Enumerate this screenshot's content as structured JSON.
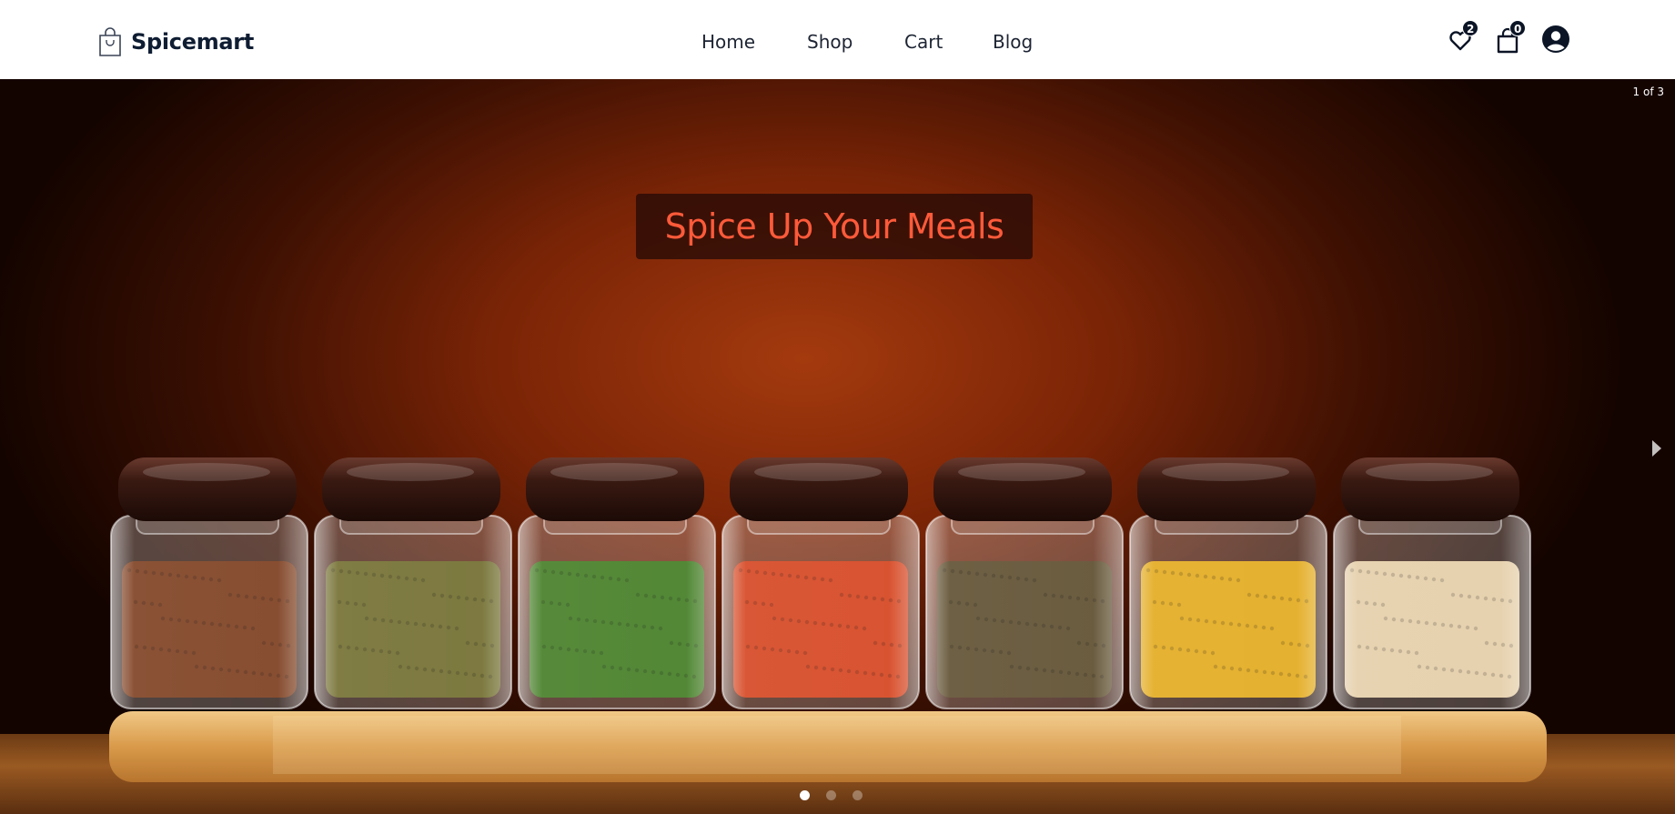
{
  "brand": {
    "name": "Spicemart",
    "icon": "shopping-bag-icon"
  },
  "nav": {
    "items": [
      {
        "label": "Home"
      },
      {
        "label": "Shop"
      },
      {
        "label": "Cart"
      },
      {
        "label": "Blog"
      }
    ]
  },
  "header_icons": {
    "wishlist": {
      "icon": "heart-icon",
      "count": "2"
    },
    "cart": {
      "icon": "shopping-bag-icon",
      "count": "0"
    },
    "account": {
      "icon": "user-circle-icon"
    }
  },
  "hero": {
    "slide_counter": "1 of 3",
    "title": "Spice Up Your Meals",
    "title_color": "#ff5a3a",
    "current_slide": 1,
    "total_slides": 3,
    "next_icon": "caret-right-icon",
    "jar_fills": [
      "#7a3a1a",
      "#6e6a2a",
      "#3f7a1f",
      "#d4401a",
      "#5a4a2a",
      "#e2a818",
      "#e4cda6"
    ]
  },
  "colors": {
    "brand_text": "#0f1d33",
    "badge_bg": "#0b1526"
  }
}
